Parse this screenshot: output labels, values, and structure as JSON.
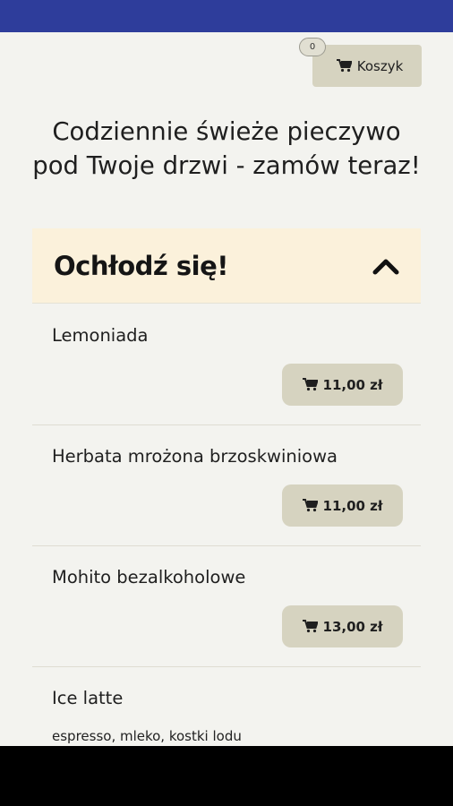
{
  "cart": {
    "label": "Koszyk",
    "count": "0",
    "icon": "cart-icon"
  },
  "headline": "Codziennie świeże pieczywo pod Twoje drzwi - zamów teraz!",
  "section": {
    "title": "Ochłodź się!",
    "toggle_icon": "chevron-up-icon",
    "header_color": "#fbf1db"
  },
  "items": [
    {
      "name": "Lemoniada",
      "description": "",
      "price": "11,00 zł"
    },
    {
      "name": "Herbata mrożona brzoskwiniowa",
      "description": "",
      "price": "11,00 zł"
    },
    {
      "name": "Mohito bezalkoholowe",
      "description": "",
      "price": "13,00 zł"
    },
    {
      "name": "Ice latte",
      "description": "espresso, mleko, kostki lodu",
      "price": ""
    }
  ],
  "colors": {
    "statusbar": "#2e3d9b",
    "button": "#d6d3c0",
    "background": "#f3f3ef"
  }
}
